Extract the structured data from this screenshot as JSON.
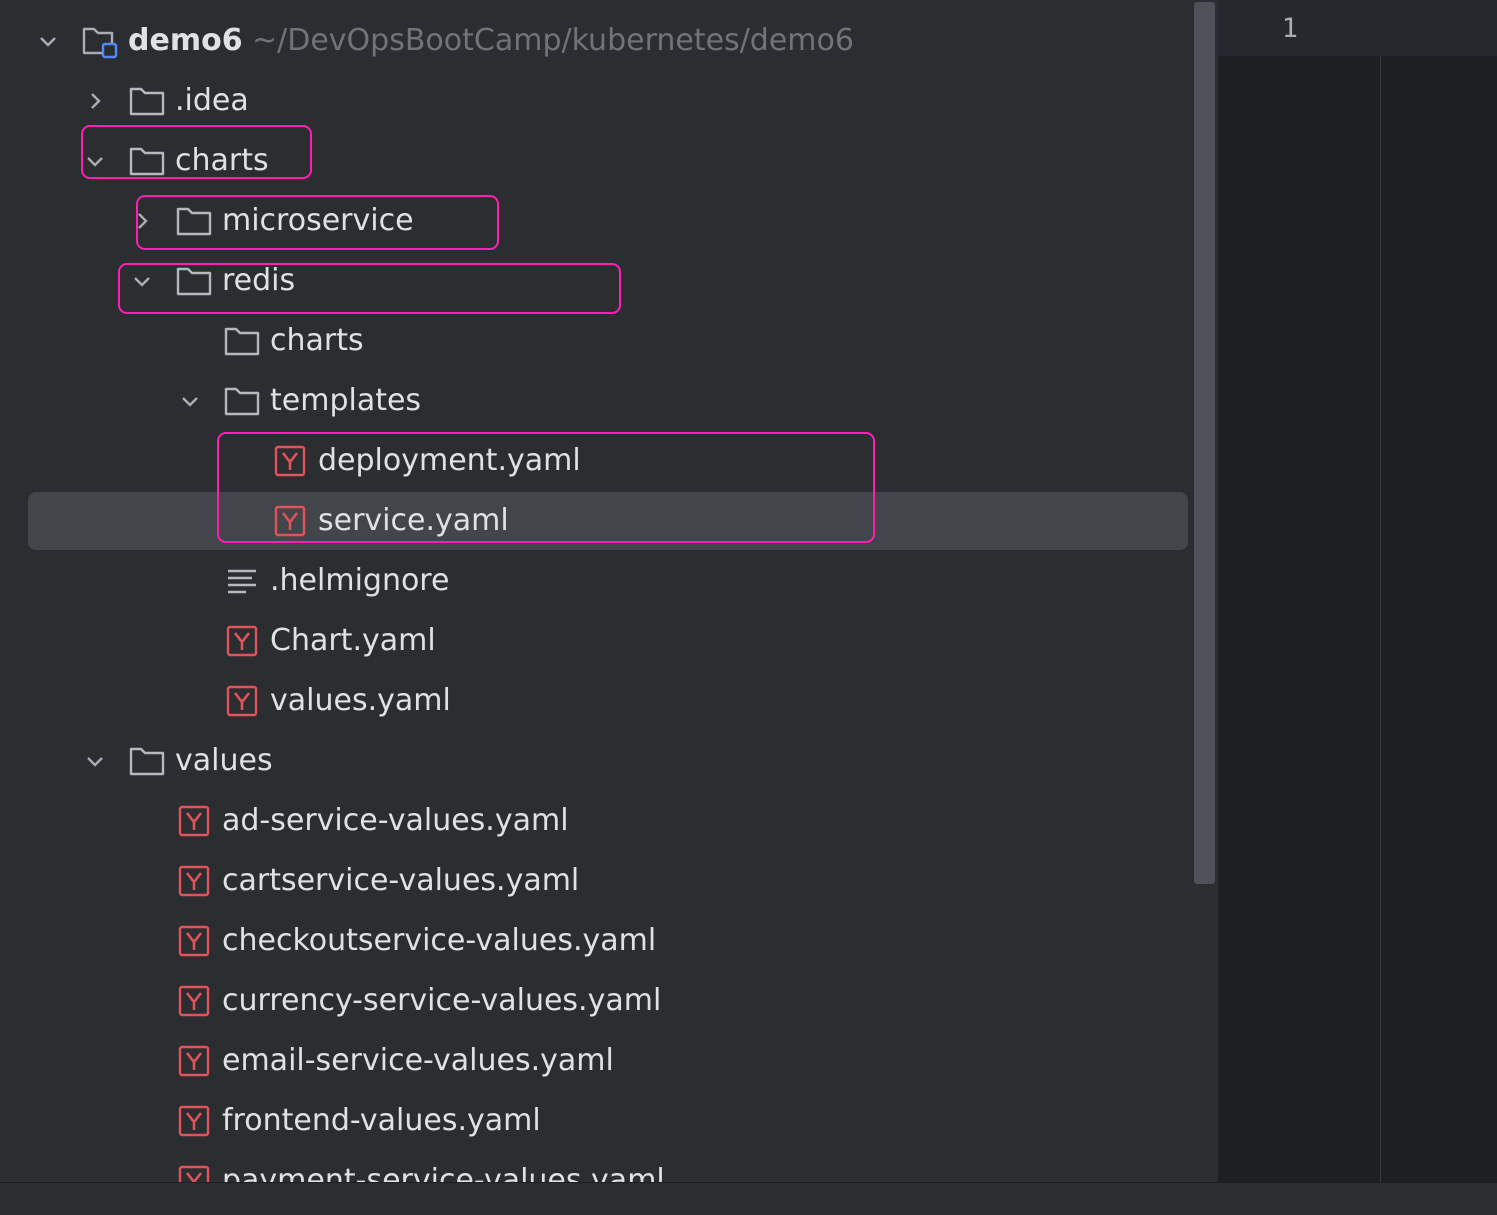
{
  "project": {
    "name": "demo6",
    "path": "~/DevOpsBootCamp/kubernetes/demo6"
  },
  "tree": [
    {
      "label": ".idea",
      "icon": "folder-icon",
      "state": "collapsed"
    },
    {
      "label": "charts",
      "icon": "folder-icon",
      "state": "expanded"
    },
    {
      "label": "microservice",
      "icon": "folder-icon",
      "state": "collapsed"
    },
    {
      "label": "redis",
      "icon": "folder-icon",
      "state": "expanded"
    },
    {
      "label": "charts",
      "icon": "folder-icon",
      "state": "none"
    },
    {
      "label": "templates",
      "icon": "folder-icon",
      "state": "expanded"
    },
    {
      "label": "deployment.yaml",
      "icon": "yaml-file-icon"
    },
    {
      "label": "service.yaml",
      "icon": "yaml-file-icon",
      "selected": true
    },
    {
      "label": ".helmignore",
      "icon": "text-file-icon"
    },
    {
      "label": "Chart.yaml",
      "icon": "yaml-file-icon"
    },
    {
      "label": "values.yaml",
      "icon": "yaml-file-icon"
    },
    {
      "label": "values",
      "icon": "folder-icon",
      "state": "expanded"
    },
    {
      "label": "ad-service-values.yaml",
      "icon": "yaml-file-icon"
    },
    {
      "label": "cartservice-values.yaml",
      "icon": "yaml-file-icon"
    },
    {
      "label": "checkoutservice-values.yaml",
      "icon": "yaml-file-icon"
    },
    {
      "label": "currency-service-values.yaml",
      "icon": "yaml-file-icon"
    },
    {
      "label": "email-service-values.yaml",
      "icon": "yaml-file-icon"
    },
    {
      "label": "frontend-values.yaml",
      "icon": "yaml-file-icon"
    },
    {
      "label": "payment-service-values.yaml",
      "icon": "yaml-file-icon"
    }
  ],
  "editor": {
    "line_number": "1"
  },
  "colors": {
    "highlight": "#ff1fb4",
    "yaml_icon": "#e0535b",
    "selection": "#43454a"
  }
}
